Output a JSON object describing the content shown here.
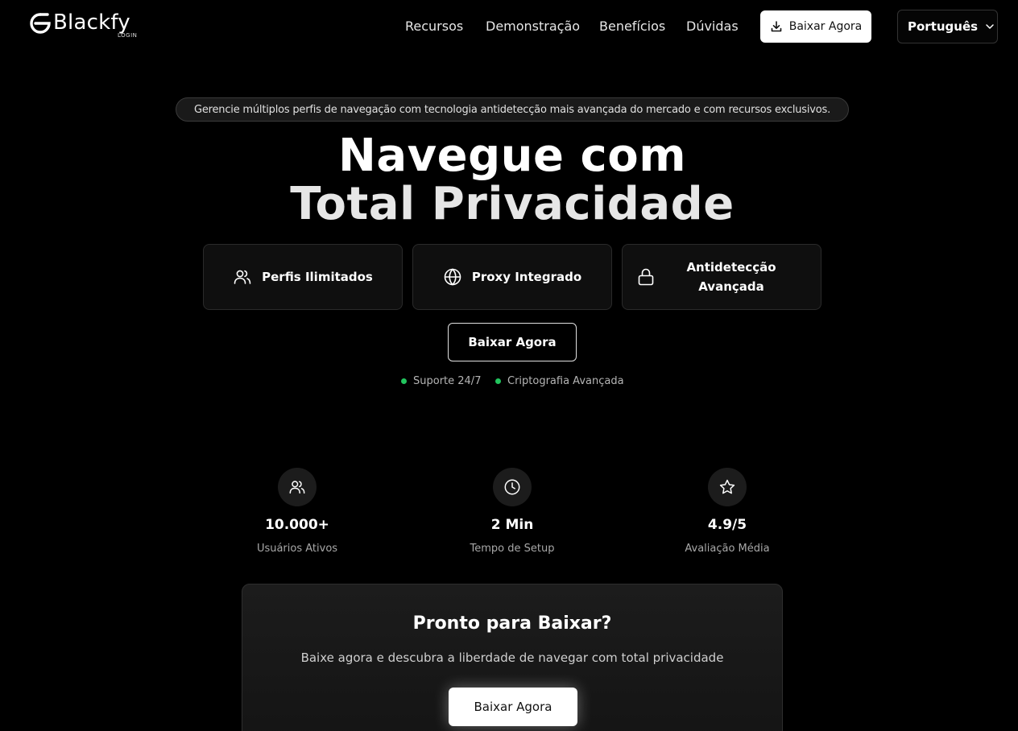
{
  "header": {
    "logo_text": "Blackfy",
    "logo_sub": "LOGIN",
    "nav": [
      "Recursos",
      "Demonstração",
      "Benefícios",
      "Dúvidas"
    ],
    "download_label": "Baixar Agora",
    "language": "Português"
  },
  "hero": {
    "pill": "Gerencie múltiplos perfis de navegação com tecnologia antidetecção mais avançada do mercado e com recursos exclusivos.",
    "title_line1": "Navegue com",
    "title_line2": "Total Privacidade",
    "features": [
      {
        "label": "Perfis Ilimitados",
        "icon": "users-icon"
      },
      {
        "label": "Proxy Integrado",
        "icon": "globe-icon"
      },
      {
        "label": "Antidetecção Avançada",
        "icon": "lock-icon"
      }
    ],
    "cta_label": "Baixar Agora",
    "trust": [
      "Suporte 24/7",
      "Criptografia Avançada"
    ]
  },
  "stats": [
    {
      "value": "10.000+",
      "label": "Usuários Ativos",
      "icon": "users-icon"
    },
    {
      "value": "2 Min",
      "label": "Tempo de Setup",
      "icon": "clock-icon"
    },
    {
      "value": "4.9/5",
      "label": "Avaliação Média",
      "icon": "star-icon"
    }
  ],
  "cta_box": {
    "title": "Pronto para Baixar?",
    "subtitle": "Baixe agora e descubra a liberdade de navegar com total privacidade",
    "button": "Baixar Agora"
  },
  "colors": {
    "background": "#000000",
    "accent_dot": "#22c55e",
    "card_bg": "#0f0f0f"
  }
}
